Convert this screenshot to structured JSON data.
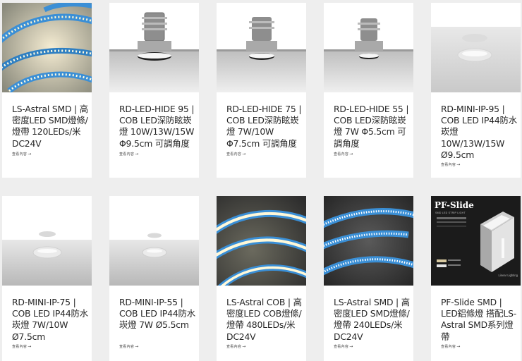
{
  "products": [
    {
      "title": "LS-Astral SMD | 高密度LED SMD燈條/燈帶 120LEDs/米 DC24V",
      "more": "查看內容",
      "image": "strip-light-image"
    },
    {
      "title": "RD-LED-HIDE 95 | COB LED深防眩崁燈 10W/13W/15W Φ9.5cm 可調角度",
      "more": "查看內容",
      "image": "recessed-downlight-image"
    },
    {
      "title": "RD-LED-HIDE 75 | COB LED深防眩崁燈 7W/10W Φ7.5cm 可調角度",
      "more": "查看內容",
      "image": "recessed-downlight-image"
    },
    {
      "title": "RD-LED-HIDE 55 | COB LED深防眩崁燈 7W Φ5.5cm 可調角度",
      "more": "查看內容",
      "image": "recessed-downlight-image"
    },
    {
      "title": "RD-MINI-IP-95 | COB LED IP44防水崁燈 10W/13W/15W Ø9.5cm",
      "more": "查看內容",
      "image": "ceiling-spot-image"
    },
    {
      "title": "RD-MINI-IP-75 | COB LED IP44防水崁燈 7W/10W Ø7.5cm",
      "more": "查看內容",
      "image": "ceiling-spot-image"
    },
    {
      "title": "RD-MINI-IP-55 | COB LED IP44防水崁燈 7W Ø5.5cm",
      "more": "查看內容",
      "image": "ceiling-spot-image"
    },
    {
      "title": "LS-Astral COB | 高密度LED COB燈條/燈帶 480LEDs/米 DC24V",
      "more": "查看內容",
      "image": "cob-strip-image"
    },
    {
      "title": "LS-Astral SMD | 高密度LED SMD燈條/燈帶 240LEDs/米 DC24V",
      "more": "查看內容",
      "image": "smd-strip-image"
    },
    {
      "title": "PF-Slide SMD | LED鋁條燈 搭配LS-Astral SMD系列燈帶",
      "more": "查看內容",
      "image": "profile-image"
    }
  ],
  "profile_image": {
    "brand": "PF-Slide",
    "subtitle": "SMD LED STRIP LIGHT",
    "tag": "Linear Lighting"
  },
  "arrow": "→",
  "colors": {
    "card": "#ffffff",
    "page": "#eeeeee",
    "text": "#262626",
    "strip_blue": "#3b8fd6"
  }
}
